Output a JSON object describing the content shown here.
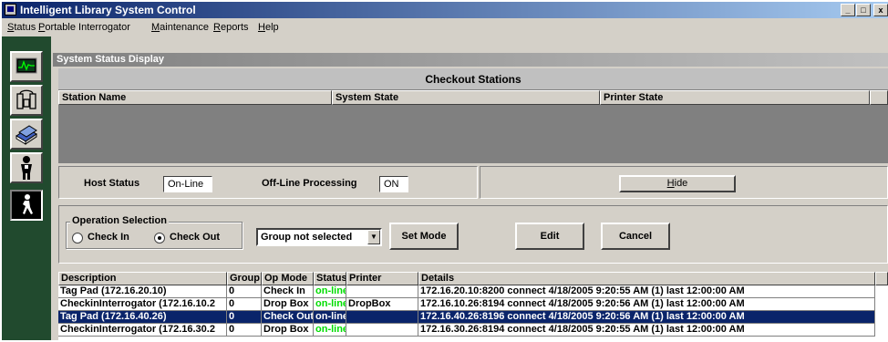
{
  "window": {
    "title": "Intelligent Library System Control",
    "minimize_glyph": "_",
    "maximize_glyph": "□",
    "close_glyph": "x"
  },
  "menu": [
    {
      "label": "Status",
      "key": "S",
      "rest": "tatus"
    },
    {
      "label": "Portable Interrogator",
      "key": "P",
      "rest": "ortable Interrogator"
    },
    {
      "label": "Maintenance",
      "key": "M",
      "rest": "aintenance"
    },
    {
      "label": "Reports",
      "key": "R",
      "rest": "eports"
    },
    {
      "label": "Help",
      "key": "H",
      "rest": "elp"
    }
  ],
  "sidebar": {
    "buttons": [
      {
        "icon": "monitor-icon"
      },
      {
        "icon": "interrogator-icon"
      },
      {
        "icon": "books-icon"
      },
      {
        "icon": "person-icon"
      },
      {
        "icon": "walking-person-icon"
      }
    ]
  },
  "main": {
    "header": "System Status Display",
    "section_title": "Checkout Stations",
    "station_columns": [
      "Station Name",
      "System State",
      "Printer State"
    ],
    "host_status_label": "Host Status",
    "host_status_value": "On-Line",
    "offline_label": "Off-Line Processing",
    "offline_value": "ON",
    "hide_key": "H",
    "hide_rest": "ide",
    "operation_group_label": "Operation Selection",
    "check_in_label": "Check In",
    "check_out_label": "Check Out",
    "selected_operation": "Check Out",
    "group_select_value": "Group not selected",
    "set_mode_label": "Set Mode",
    "edit_label": "Edit",
    "cancel_label": "Cancel"
  },
  "devices": {
    "columns": [
      "Description",
      "Group",
      "Op Mode",
      "Status",
      "Printer",
      "Details"
    ],
    "rows": [
      {
        "description": "Tag Pad (172.16.20.10)",
        "group": "0",
        "op_mode": "Check In",
        "status": "on-line",
        "printer": "",
        "details": "172.16.20.10:8200 connect 4/18/2005 9:20:55 AM (1) last 12:00:00 AM",
        "selected": false
      },
      {
        "description": "CheckinInterrogator (172.16.10.2",
        "group": "0",
        "op_mode": "Drop Box",
        "status": "on-line",
        "printer": "DropBox",
        "details": "172.16.10.26:8194 connect 4/18/2005 9:20:56 AM (1) last 12:00:00 AM",
        "selected": false
      },
      {
        "description": "Tag Pad (172.16.40.26)",
        "group": "0",
        "op_mode": "Check Out",
        "status": "on-line",
        "printer": "",
        "details": "172.16.40.26:8196 connect 4/18/2005 9:20:56 AM (1) last 12:00:00 AM",
        "selected": true
      },
      {
        "description": "CheckinInterrogator (172.16.30.2",
        "group": "0",
        "op_mode": "Drop Box",
        "status": "on-line",
        "printer": "",
        "details": "172.16.30.26:8194 connect 4/18/2005 9:20:55 AM (1) last 12:00:00 AM",
        "selected": false
      }
    ]
  }
}
